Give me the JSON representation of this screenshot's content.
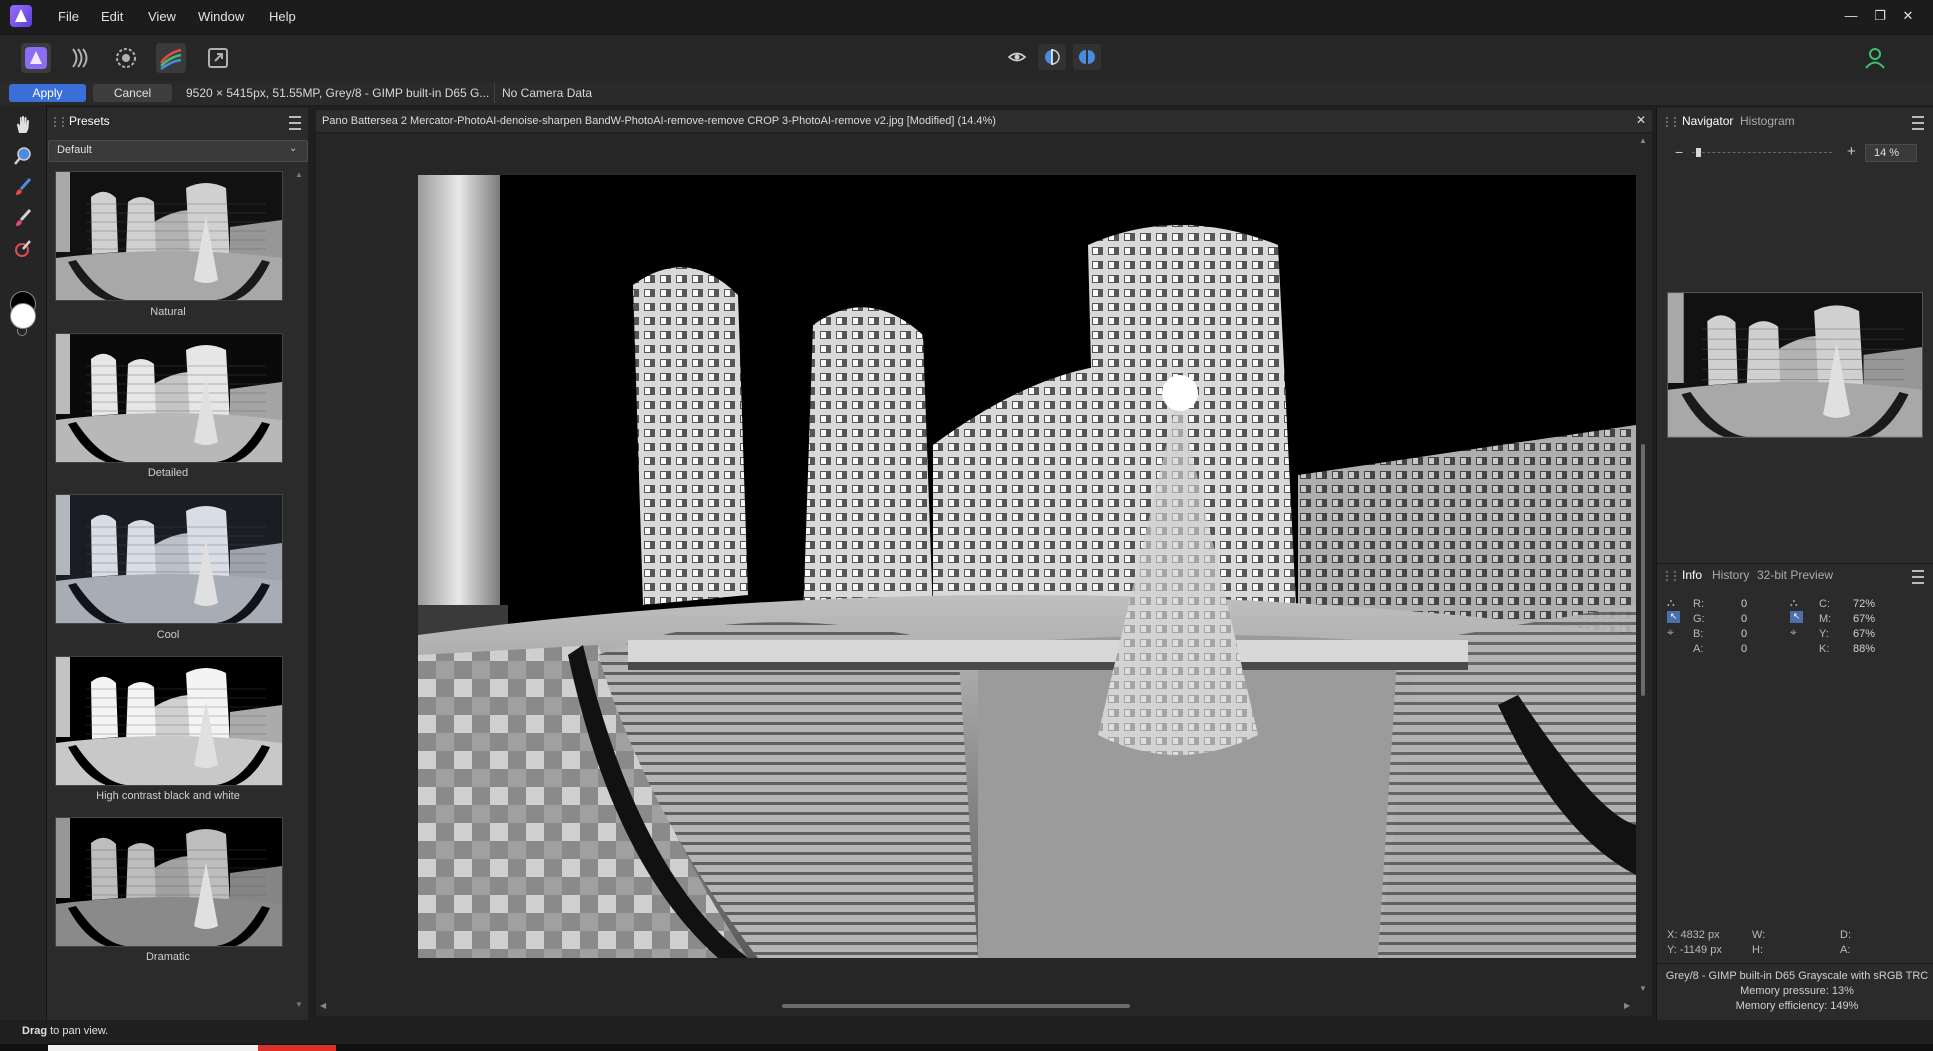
{
  "menu": {
    "items": [
      "File",
      "Edit",
      "View",
      "Window",
      "Help"
    ]
  },
  "window_controls": {
    "minimize": "—",
    "restore": "❐",
    "close": "✕"
  },
  "context_bar": {
    "apply_label": "Apply",
    "cancel_label": "Cancel",
    "image_info": "9520 × 5415px, 51.55MP, Grey/8 - GIMP built-in D65 G...",
    "camera_data": "No Camera Data"
  },
  "presets_panel": {
    "tab": "Presets",
    "selected": "Default",
    "items": [
      {
        "label": "Natural"
      },
      {
        "label": "Detailed"
      },
      {
        "label": "Cool"
      },
      {
        "label": "High contrast black and white"
      },
      {
        "label": "Dramatic"
      }
    ]
  },
  "document": {
    "title": "Pano Battersea 2 Mercator-PhotoAI-denoise-sharpen BandW-PhotoAI-remove-remove CROP 3-PhotoAI-remove v2.jpg [Modified] (14.4%)",
    "close": "✕"
  },
  "navigator_panel": {
    "tabs": [
      "Navigator",
      "Histogram"
    ],
    "zoom_value": "14 %",
    "zoom_fraction": 0.03
  },
  "info_panel": {
    "tabs": [
      "Info",
      "History",
      "32-bit Preview"
    ],
    "rgba": [
      {
        "label": "R:",
        "value": "0"
      },
      {
        "label": "G:",
        "value": "0"
      },
      {
        "label": "B:",
        "value": "0"
      },
      {
        "label": "A:",
        "value": "0"
      }
    ],
    "cmyk": [
      {
        "label": "C:",
        "value": "72%"
      },
      {
        "label": "M:",
        "value": "67%"
      },
      {
        "label": "Y:",
        "value": "67%"
      },
      {
        "label": "K:",
        "value": "88%"
      }
    ],
    "x_coord": "X: 4832 px",
    "y_coord": "Y: -1149 px",
    "w_label": "W:",
    "h_label": "H:",
    "d_label": "D:",
    "a_label": "A:",
    "color_profile": "Grey/8 - GIMP built-in D65 Grayscale with sRGB TRC",
    "memory_pressure": "Memory pressure: 13%",
    "memory_efficiency": "Memory efficiency: 149%"
  },
  "status_bar": {
    "bold": "Drag",
    "rest": " to pan view."
  },
  "colors": {
    "accent": "#3a6fd8",
    "panel_bg": "#2b2b2b",
    "user_icon": "#3fbf6f"
  }
}
